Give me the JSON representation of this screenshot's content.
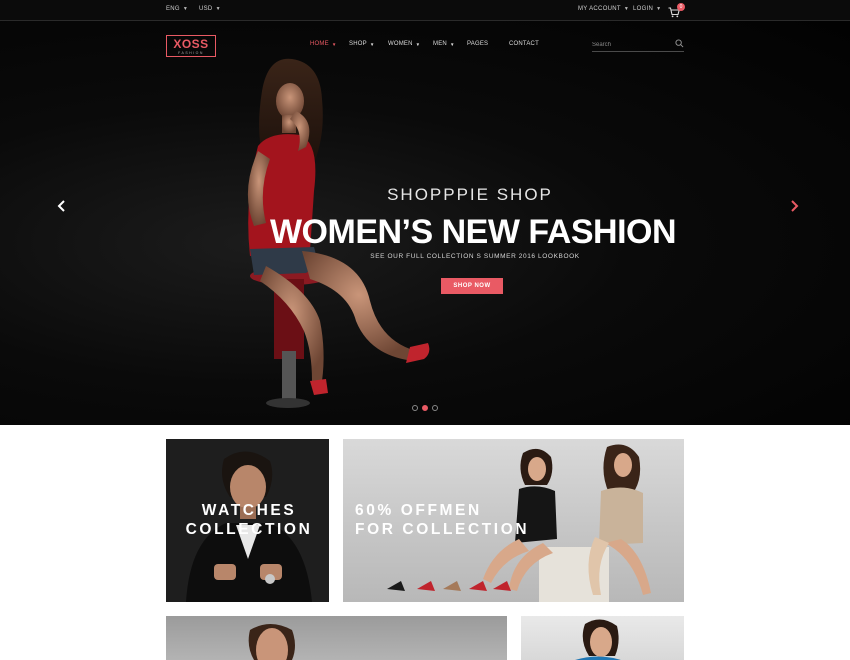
{
  "topbar": {
    "language": "ENG",
    "currency": "USD",
    "account": "MY ACCOUNT",
    "login": "LOGIN",
    "cart_count": "0"
  },
  "nav": {
    "logo_main": "XOSS",
    "logo_sub": "FASHION",
    "items": [
      {
        "label": "HOME",
        "has_dropdown": true
      },
      {
        "label": "SHOP",
        "has_dropdown": true
      },
      {
        "label": "WOMEN",
        "has_dropdown": true
      },
      {
        "label": "MEN",
        "has_dropdown": true
      },
      {
        "label": "PAGES",
        "has_dropdown": false
      },
      {
        "label": "CONTACT",
        "has_dropdown": false
      }
    ],
    "search_placeholder": "Search"
  },
  "hero": {
    "subtitle": "SHOPPPIE SHOP",
    "title": "WOMEN’S NEW FASHION",
    "description": "SEE OUR FULL COLLECTION S SUMMER 2016 LOOKBOOK",
    "button": "SHOP NOW",
    "slide_count": 3,
    "active_slide": 2
  },
  "banners": {
    "watches_line1": "WATCHES",
    "watches_line2": "COLLECTION",
    "offer_line1": "60% OFFMEN",
    "offer_line2": "FOR COLLECTION"
  },
  "colors": {
    "accent": "#e95a64",
    "dark": "#0b0b0b"
  }
}
